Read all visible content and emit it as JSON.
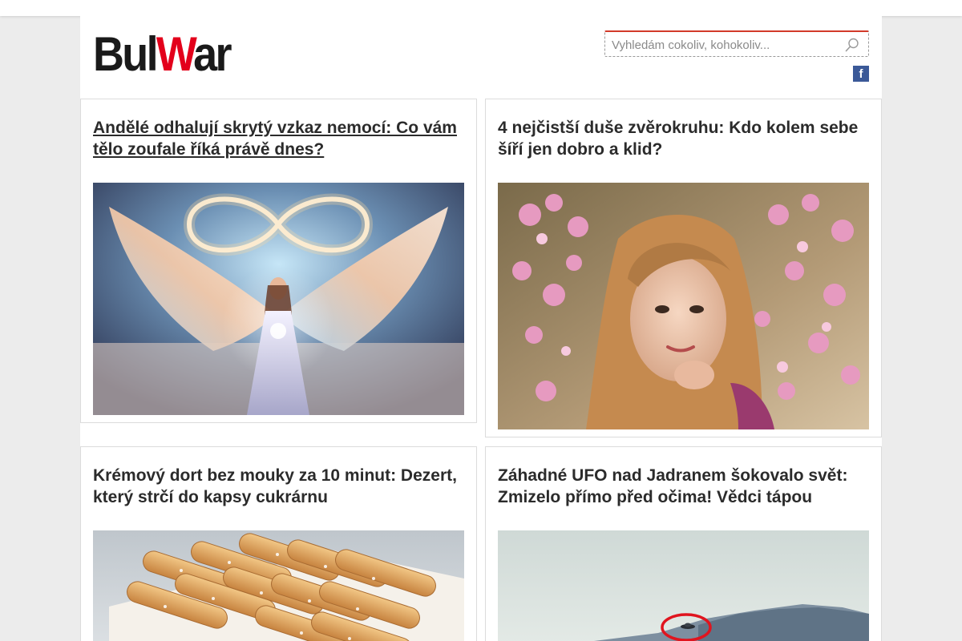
{
  "header": {
    "logo_part1": "Bul",
    "logo_part2": "W",
    "logo_part3": "ar",
    "search_placeholder": "Vyhledám cokoliv, kohokoliv...",
    "facebook_glyph": "f",
    "search_icon": "search-icon",
    "facebook_icon": "facebook-icon"
  },
  "colors": {
    "brand_red": "#e3001b",
    "logo_dark": "#1a1a1a",
    "title_text": "#2b2b2b",
    "facebook_blue": "#3b5998",
    "page_bg": "#ececec"
  },
  "articles": [
    {
      "title": "Andělé odhalují skrytý vzkaz nemocí: Co vám tělo zoufale říká právě dnes?",
      "image": "angel-with-infinity-halo-image",
      "underlined": true
    },
    {
      "title": "4 nejčistší duše zvěrokruhu: Kdo kolem sebe šíří jen dobro a klid?",
      "image": "woman-among-pink-blossoms-image"
    },
    {
      "title": "Krémový dort bez mouky za 10 minut: Dezert, který strčí do kapsy cukrárnu",
      "image": "ladyfinger-cream-cake-image"
    },
    {
      "title": "Záhadné UFO nad Jadranem šokovalo svět: Zmizelo přímo před očima! Vědci tápou",
      "image": "ufo-over-adriatic-image"
    }
  ]
}
